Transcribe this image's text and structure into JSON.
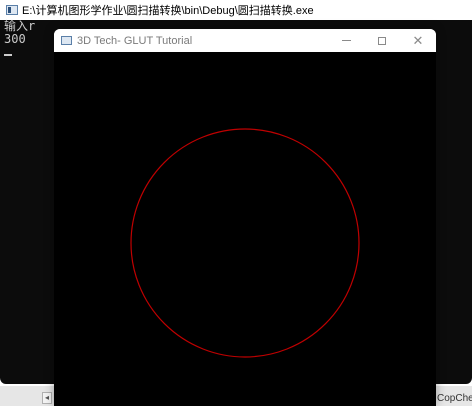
{
  "console": {
    "title": "E:\\计算机图形学作业\\圆扫描转换\\bin\\Debug\\圆扫描转换.exe",
    "lines": [
      "输入r",
      "300"
    ]
  },
  "glut": {
    "title": "3D Tech- GLUT Tutorial",
    "circle_color": "#c00000"
  },
  "background": {
    "bottom_text": "CopChec"
  },
  "colors": {
    "console_bg": "#0c0c0c",
    "console_text": "#cccccc",
    "canvas_bg": "#000000"
  }
}
